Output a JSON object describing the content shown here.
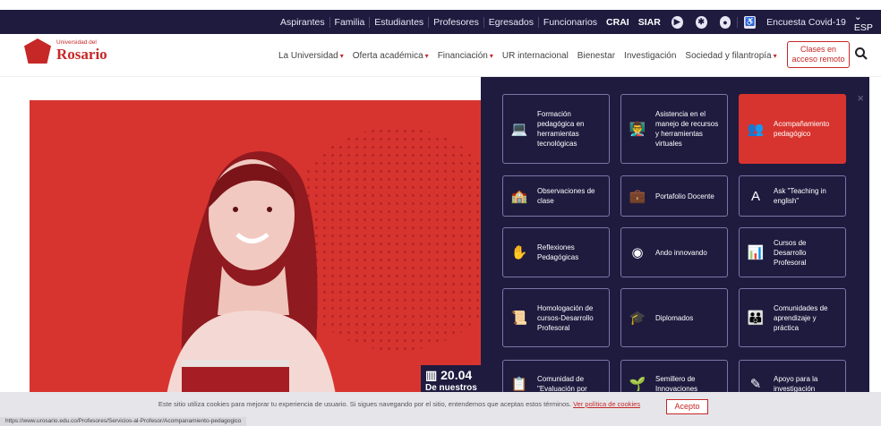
{
  "topbar": {
    "links": [
      "Aspirantes",
      "Familia",
      "Estudiantes",
      "Profesores",
      "Egresados",
      "Funcionarios"
    ],
    "bold_links": [
      "CRAI",
      "SIAR"
    ],
    "icons": [
      "youtube-icon",
      "network-icon",
      "play-icon",
      "accessibility-icon"
    ],
    "covid_label": "Encuesta Covid-19",
    "lang_label": "ESP"
  },
  "header": {
    "logo_small": "Universidad del",
    "logo_big": "Rosario",
    "nav": [
      {
        "label": "La Universidad",
        "has_caret": true
      },
      {
        "label": "Oferta académica",
        "has_caret": true
      },
      {
        "label": "Financiación",
        "has_caret": true
      },
      {
        "label": "UR internacional",
        "has_caret": false
      },
      {
        "label": "Bienestar",
        "has_caret": false
      },
      {
        "label": "Investigación",
        "has_caret": false
      },
      {
        "label": "Sociedad y filantropía",
        "has_caret": true
      }
    ],
    "remote_button": "Clases en acceso remoto"
  },
  "hero": {
    "stat_number": "20.04",
    "stat_sub": "De nuestros"
  },
  "mega_menu": {
    "cards": [
      {
        "label": "Formación pedagógica en herramientas tecnológicas",
        "icon": "laptop-icon",
        "active": false
      },
      {
        "label": "Asistencia en el manejo de recursos y herramientas virtuales",
        "icon": "teacher-icon",
        "active": false
      },
      {
        "label": "Acompañamiento pedagógico",
        "icon": "group-icon",
        "active": true
      },
      {
        "label": "Observaciones de clase",
        "icon": "classroom-icon",
        "active": false
      },
      {
        "label": "Portafolio Docente",
        "icon": "briefcase-icon",
        "active": false
      },
      {
        "label": "Ask \"Teaching in english\"",
        "icon": "ask-icon",
        "active": false
      },
      {
        "label": "Reflexiones Pedagógicas",
        "icon": "reflection-icon",
        "active": false
      },
      {
        "label": "Ando innovando",
        "icon": "head-icon",
        "active": false
      },
      {
        "label": "Cursos de Desarrollo Profesoral",
        "icon": "presenter-icon",
        "active": false
      },
      {
        "label": "Homologación de cursos-Desarrollo Profesoral",
        "icon": "certificate-icon",
        "active": false
      },
      {
        "label": "Diplomados",
        "icon": "graduation-icon",
        "active": false
      },
      {
        "label": "Comunidades de aprendizaje y práctica",
        "icon": "community-icon",
        "active": false
      },
      {
        "label": "Comunidad de \"Evaluación por",
        "icon": "evaluation-icon",
        "active": false
      },
      {
        "label": "Semillero de Innovaciones",
        "icon": "seedling-icon",
        "active": false
      },
      {
        "label": "Apoyo para la investigación",
        "icon": "pencil-icon",
        "active": false
      }
    ]
  },
  "cookie": {
    "text": "Este sitio utiliza cookies para mejorar tu experiencia de usuario. Si sigues navegando por el sitio, entendemos que aceptas estos términos.",
    "link": "Ver política de cookies",
    "accept": "Acepto"
  },
  "status_url": "https://www.urosario.edu.co/Profesores/Servicios-al-Profesor/Acompanamiento-pedagogico"
}
